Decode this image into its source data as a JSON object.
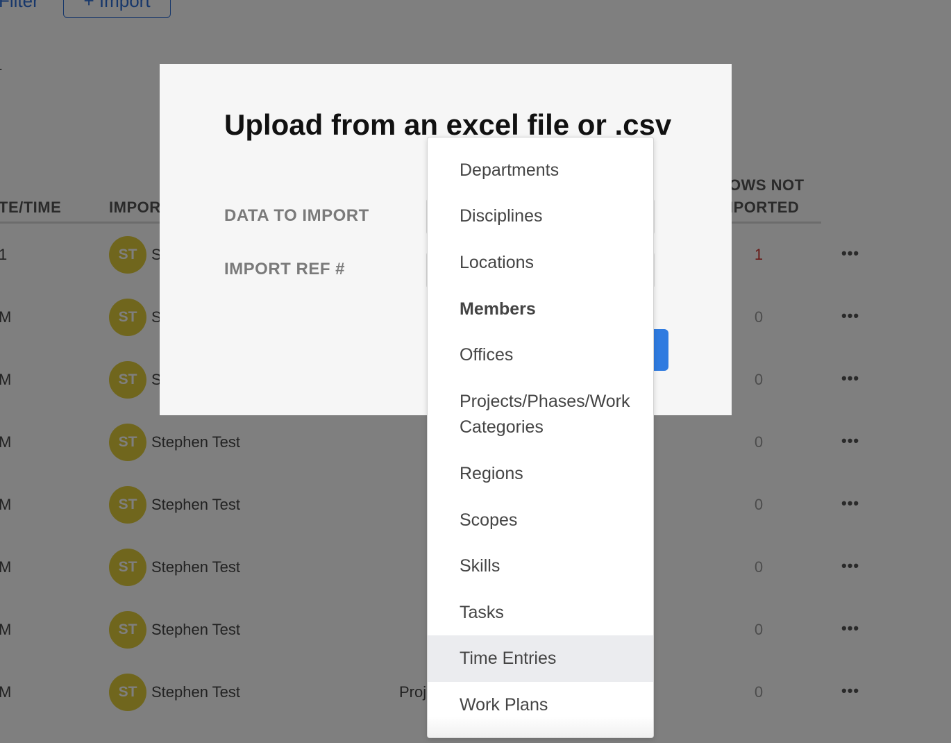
{
  "toolbar": {
    "filter_label": "Filter",
    "import_label": "+ Import"
  },
  "table": {
    "headers": {
      "datetime": "TE/TIME",
      "importer": "IMPOR",
      "not_imported_line1": "OWS NOT",
      "not_imported_line2": "IPORTED"
    },
    "stray_mark": "-",
    "rows": [
      {
        "time": "1",
        "initials": "ST",
        "name": "S",
        "extra": "",
        "not_imported": "1"
      },
      {
        "time": "M",
        "initials": "ST",
        "name": "S",
        "extra": "",
        "not_imported": "0"
      },
      {
        "time": "M",
        "initials": "ST",
        "name": "S",
        "extra": "",
        "not_imported": "0"
      },
      {
        "time": "M",
        "initials": "ST",
        "name": "Stephen Test",
        "extra": "",
        "not_imported": "0"
      },
      {
        "time": "M",
        "initials": "ST",
        "name": "Stephen Test",
        "extra": "",
        "not_imported": "0"
      },
      {
        "time": "M",
        "initials": "ST",
        "name": "Stephen Test",
        "extra": "",
        "not_imported": "0"
      },
      {
        "time": "M",
        "initials": "ST",
        "name": "Stephen Test",
        "extra": "",
        "not_imported": "0"
      },
      {
        "time": "M",
        "initials": "ST",
        "name": "Stephen Test",
        "extra": "Proj",
        "not_imported": "0"
      }
    ],
    "row_menu_glyph": "•••"
  },
  "modal": {
    "title": "Upload from an excel file or .csv",
    "data_to_import_label": "DATA TO IMPORT",
    "import_ref_label": "IMPORT REF #"
  },
  "dropdown": {
    "options": [
      "Departments",
      "Disciplines",
      "Locations",
      "Members",
      "Offices",
      "Projects/Phases/Work Categories",
      "Regions",
      "Scopes",
      "Skills",
      "Tasks",
      "Time Entries",
      "Work Plans"
    ],
    "selected": "Members",
    "hovered": "Time Entries"
  },
  "colors": {
    "accent": "#2f7be0",
    "avatar": "#e0cd3b",
    "error": "#d0352f"
  }
}
